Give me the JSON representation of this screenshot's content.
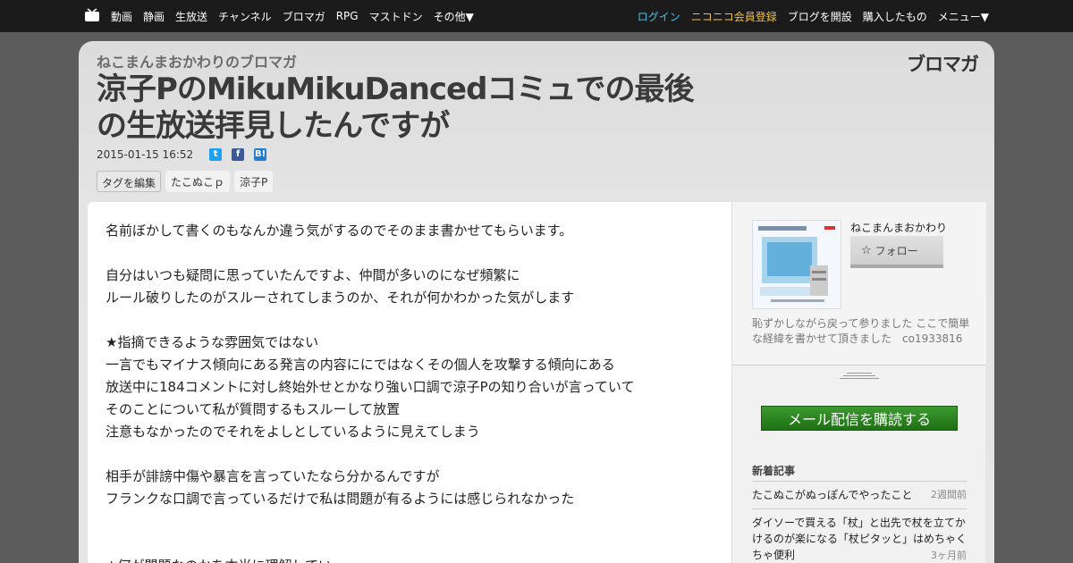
{
  "topnav": {
    "left": [
      "動画",
      "静画",
      "生放送",
      "チャンネル",
      "ブロマガ",
      "RPG",
      "マストドン",
      "その他▼"
    ],
    "login": "ログイン",
    "premium": "ニコニコ会員登録",
    "right": [
      "ブログを開設",
      "購入したもの",
      "メニュー▼"
    ]
  },
  "header": {
    "blog_name": "ねこまんまおかわりのブロマガ",
    "logo": "ブロマガ",
    "title": "涼子PのMikuMikuDancedコミュでの最後の生放送拝見したんですが",
    "date": "2015-01-15 16:52",
    "share": {
      "twitter": "t",
      "facebook": "f",
      "hatena": "B!"
    },
    "tag_edit": "タグを編集",
    "tags": [
      "たこぬこｐ",
      "涼子P"
    ]
  },
  "content": {
    "lines": [
      "名前ぼかして書くのもなんか違う気がするのでそのまま書かせてもらいます。",
      "",
      "自分はいつも疑問に思っていたんですよ、仲間が多いのになぜ頻繁に",
      "ルール破りしたのがスルーされてしまうのか、それが何かわかった気がします",
      "",
      "★指摘できるような雰囲気ではない",
      "一言でもマイナス傾向にある発言の内容ににではなくその個人を攻撃する傾向にある",
      "放送中に184コメントに対し終始外せとかなり強い口調で涼子Pの知り合いが言っていて",
      "そのことについて私が質問するもスルーして放置",
      "注意もなかったのでそれをよしとしているように見えてしまう",
      "",
      "相手が誹謗中傷や暴言を言っていたなら分かるんですが",
      "フランクな口調で言っているだけで私は問題が有るようには感じられなかった",
      "",
      "",
      "★何が問題なのかを本当に理解してい"
    ]
  },
  "sidebar": {
    "author": "ねこまんまおかわり",
    "follow": "フォロー",
    "description": "恥ずかしながら戻って参りました ここで簡単な経緯を書かせて頂きました　co1933816",
    "subscribe": "メール配信を購読する",
    "recent_heading": "新着記事",
    "recent": [
      {
        "title": "たこぬこがぬっぽんでやったこと",
        "ago": "2週間前"
      },
      {
        "title": "ダイソーで買える「杖」と出先で杖を立てかけるのが楽になる「杖ピタッと」はめちゃくちゃ便利",
        "ago": "3ヶ月前"
      }
    ]
  }
}
